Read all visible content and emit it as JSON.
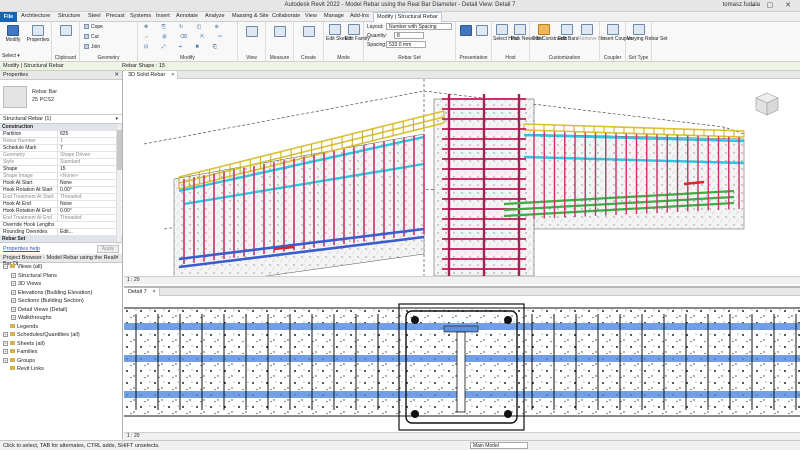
{
  "window": {
    "title": "Autodesk Revit 2022 - Model Rebar using the Real Bar Diameter - Detail View: Detail 7",
    "user": "tomasz.fudala",
    "controls": "– ▢ ✕"
  },
  "tabs": [
    "File",
    "Architecture",
    "Structure",
    "Steel",
    "Precast",
    "Systems",
    "Insert",
    "Annotate",
    "Analyze",
    "Massing & Site",
    "Collaborate",
    "View",
    "Manage",
    "Add-Ins",
    "Modify | Structural Rebar"
  ],
  "ribbon": {
    "modify": "Modify",
    "select": "Select ▾",
    "properties": "Properties",
    "clipboard": "Clipboard",
    "cope": "Cope",
    "cut": "Cut",
    "join": "Join",
    "geometry": "Geometry",
    "modify_panel": "Modify",
    "view": "View",
    "measure": "Measure",
    "create": "Create",
    "edit_sketch": "Edit Sketch",
    "edit_family": "Edit Family",
    "mode": "Mode",
    "layout_label": "Layout:",
    "layout_value": "Number with Spacing",
    "quantity_label": "Quantity:",
    "quantity_value": "8",
    "spacing_label": "Spacing:",
    "spacing_value": "533.0 mm",
    "rebar_set": "Rebar Set",
    "presentation": "Presentation",
    "select_host": "Select Host",
    "pick_new_host": "Pick New Host",
    "host": "Host",
    "edit_constraints": "Edit Constraints",
    "edit_bars": "Edit Bars",
    "remove_bar": "Remove Bar",
    "customization": "Customization",
    "insert_coupler": "Insert Coupler",
    "coupler": "Coupler",
    "varying_rebar_set": "Varying Rebar Set",
    "set_type": "Set Type"
  },
  "context": {
    "label": "Modify | Structural Rebar",
    "shape": "Rebar Shape : 15"
  },
  "properties": {
    "title": "Properties",
    "type_name": "Rebar Bar",
    "type_sub": "25 PCS2",
    "filter": "Structural Rebar (1)",
    "edit_type": "Edit Type",
    "rows": [
      {
        "k": "Construction",
        "v": "",
        "grp": true
      },
      {
        "k": "Partition",
        "v": "825",
        "dim": false
      },
      {
        "k": "Rebar Number",
        "v": "1",
        "dim": true
      },
      {
        "k": "Schedule Mark",
        "v": "7",
        "dim": false
      },
      {
        "k": "Geometry",
        "v": "Shape Driven",
        "dim": true
      },
      {
        "k": "Style",
        "v": "Standard",
        "dim": true
      },
      {
        "k": "Shape",
        "v": "15",
        "dim": false
      },
      {
        "k": "Shape Image",
        "v": "<None>",
        "dim": true
      },
      {
        "k": "Hook At Start",
        "v": "None",
        "dim": false
      },
      {
        "k": "Hook Rotation At Start",
        "v": "0.00°",
        "dim": false
      },
      {
        "k": "End Treatment At Start",
        "v": "Threaded",
        "dim": true
      },
      {
        "k": "Hook At End",
        "v": "None",
        "dim": false
      },
      {
        "k": "Hook Rotation At End",
        "v": "0.00°",
        "dim": false
      },
      {
        "k": "End Treatment At End",
        "v": "Threaded",
        "dim": true
      },
      {
        "k": "Override Hook Lengths",
        "v": "",
        "dim": false
      },
      {
        "k": "Rounding Overrides",
        "v": "Edit...",
        "dim": false
      },
      {
        "k": "Rebar Set",
        "v": "",
        "grp": true
      }
    ],
    "help": "Properties help",
    "apply": "Apply"
  },
  "browser": {
    "title": "Project Browser - Model Rebar using the Real Bar Di...",
    "items": [
      {
        "label": "Views (all)",
        "lvl": 0,
        "ex": "−"
      },
      {
        "label": "Structural Plans",
        "lvl": 1,
        "ex": "+"
      },
      {
        "label": "3D Views",
        "lvl": 1,
        "ex": "+"
      },
      {
        "label": "Elevations (Building Elevation)",
        "lvl": 1,
        "ex": "+"
      },
      {
        "label": "Sections (Building Section)",
        "lvl": 1,
        "ex": "+"
      },
      {
        "label": "Detail Views (Detail)",
        "lvl": 1,
        "ex": "+"
      },
      {
        "label": "Walkthroughs",
        "lvl": 1,
        "ex": "+"
      },
      {
        "label": "Legends",
        "lvl": 0,
        "ex": ""
      },
      {
        "label": "Schedules/Quantities (all)",
        "lvl": 0,
        "ex": "+"
      },
      {
        "label": "Sheets (all)",
        "lvl": 0,
        "ex": "+"
      },
      {
        "label": "Families",
        "lvl": 0,
        "ex": "+"
      },
      {
        "label": "Groups",
        "lvl": 0,
        "ex": "+"
      },
      {
        "label": "Revit Links",
        "lvl": 0,
        "ex": ""
      }
    ]
  },
  "view3d": {
    "tab": "3D Solid Rebar",
    "scale": "1 : 20"
  },
  "view2d": {
    "tab": "Detail 7",
    "scale": "1 : 20"
  },
  "status": {
    "message": "Click to select, TAB for alternates, CTRL adds, SHIFT unselects.",
    "model": "Main Model"
  },
  "colors": {
    "accent": "#1665b5",
    "rebar_main": "#c8316b",
    "rebar_top": "#d9c32a",
    "rebar_cyan": "#2fc4e0",
    "rebar_blue": "#3b5ccf",
    "rebar_green": "#3cae43",
    "rebar_red": "#d9262a"
  }
}
